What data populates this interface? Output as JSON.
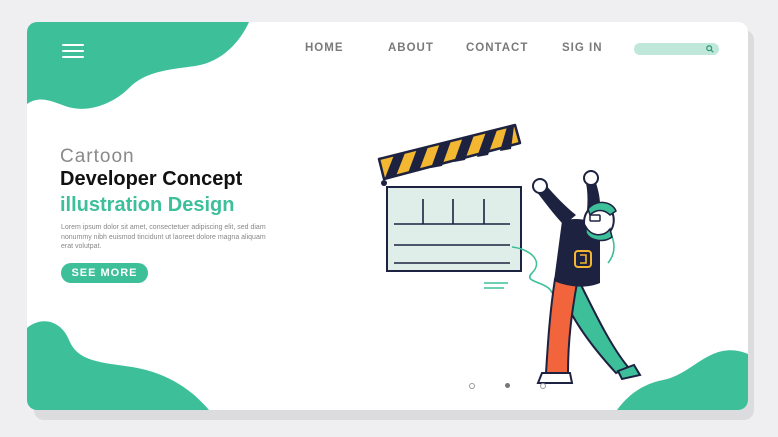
{
  "nav": {
    "items": [
      {
        "label": "HOME"
      },
      {
        "label": "ABOUT"
      },
      {
        "label": "CONTACT"
      },
      {
        "label": "SIG IN"
      }
    ],
    "search_placeholder": ""
  },
  "hero": {
    "line1": "Cartoon",
    "line2": "Developer Concept",
    "line3": "illustration Design",
    "body": "Lorem ipsum dolor sit amet, consectetuer adipiscing elit, sed diam nonummy nibh euismod tincidunt ut laoreet dolore magna aliquam erat volutpat.",
    "cta_label": "SEE MORE"
  },
  "pagination": {
    "count": 3,
    "active_index": 1
  },
  "colors": {
    "accent": "#3dbf9a",
    "clapper_yellow": "#f4b731",
    "pants_orange": "#f2643c",
    "shirt_navy": "#1d2240"
  }
}
